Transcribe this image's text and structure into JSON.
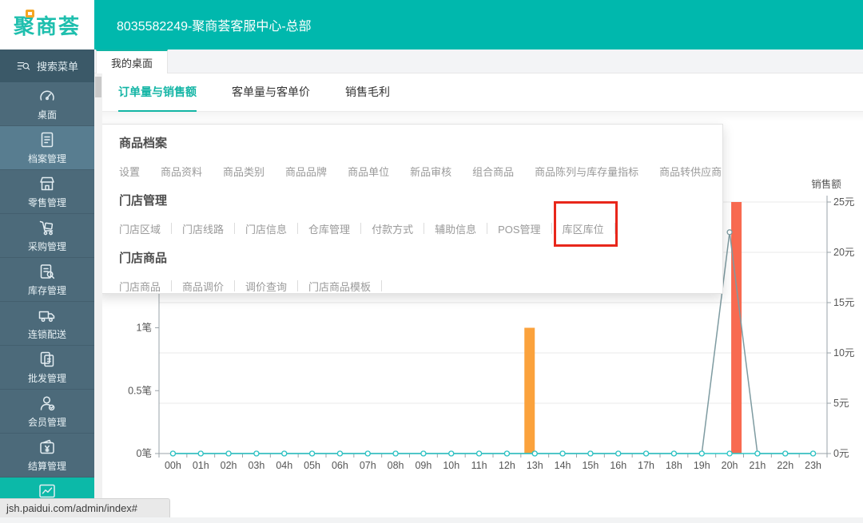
{
  "header": {
    "logo_text": "聚商荟",
    "window_title": "8035582249-聚商荟客服中心-总部"
  },
  "browser_tab": {
    "label": "我的桌面"
  },
  "search_menu": {
    "label": "搜索菜单",
    "icon": "search-menu-icon"
  },
  "sidebar": {
    "items": [
      {
        "label": "桌面",
        "icon": "dashboard-icon",
        "active": false
      },
      {
        "label": "档案管理",
        "icon": "archive-icon",
        "active": true
      },
      {
        "label": "零售管理",
        "icon": "store-icon",
        "active": false
      },
      {
        "label": "采购管理",
        "icon": "trolley-icon",
        "active": false
      },
      {
        "label": "库存管理",
        "icon": "inventory-search-icon",
        "active": false
      },
      {
        "label": "连锁配送",
        "icon": "truck-icon",
        "active": false
      },
      {
        "label": "批发管理",
        "icon": "documents-icon",
        "active": false
      },
      {
        "label": "会员管理",
        "icon": "member-icon",
        "active": false
      },
      {
        "label": "结算管理",
        "icon": "wallet-icon",
        "active": false
      },
      {
        "label": "",
        "icon": "line-chart-icon",
        "active": true,
        "partial": true
      }
    ]
  },
  "subtabs": [
    {
      "label": "订单量与销售额",
      "active": true
    },
    {
      "label": "客单量与客单价",
      "active": false
    },
    {
      "label": "销售毛利",
      "active": false
    }
  ],
  "menu": {
    "sections": [
      {
        "title": "商品档案",
        "items": [
          "设置",
          "商品资料",
          "商品类别",
          "商品品牌",
          "商品单位",
          "新品审核",
          "组合商品",
          "商品陈列与库存量指标",
          "商品转供应商"
        ]
      },
      {
        "title": "门店管理",
        "items": [
          "门店区域",
          "门店线路",
          "门店信息",
          "仓库管理",
          "付款方式",
          "辅助信息",
          "POS管理",
          "库区库位"
        ]
      },
      {
        "title": "门店商品",
        "items": [
          "门店商品",
          "商品调价",
          "调价查询",
          "门店商品模板"
        ]
      }
    ],
    "highlighted_item": "库区库位",
    "highlight_color": "#e8271b"
  },
  "chart_data": {
    "type": "bar+line combo",
    "categories": [
      "00h",
      "01h",
      "02h",
      "03h",
      "04h",
      "05h",
      "06h",
      "07h",
      "08h",
      "09h",
      "10h",
      "11h",
      "12h",
      "13h",
      "14h",
      "15h",
      "16h",
      "17h",
      "18h",
      "19h",
      "20h",
      "21h",
      "22h",
      "23h"
    ],
    "left_axis": {
      "unit": "笔",
      "max": 2,
      "visible_ticks": [
        {
          "label": "0笔",
          "value": 0
        },
        {
          "label": "0.5笔",
          "value": 0.5
        },
        {
          "label": "1笔",
          "value": 1
        }
      ]
    },
    "right_axis": {
      "title": "销售额",
      "unit": "元",
      "max": 25,
      "ticks": [
        {
          "label": "0元",
          "value": 0
        },
        {
          "label": "5元",
          "value": 5
        },
        {
          "label": "10元",
          "value": 10
        },
        {
          "label": "15元",
          "value": 15
        },
        {
          "label": "20元",
          "value": 20
        },
        {
          "label": "25元",
          "value": 25
        }
      ]
    },
    "grid": "horizontal lines at every 5元 step",
    "legend_visible": false,
    "series": [
      {
        "id": "bar-orange",
        "type": "bar",
        "axis": "left",
        "slot": 0,
        "color": "#fba23c",
        "values": [
          0,
          0,
          0,
          0,
          0,
          0,
          0,
          0,
          0,
          0,
          0,
          0,
          0,
          1,
          0,
          0,
          0,
          0,
          0,
          0,
          0,
          0,
          0,
          0
        ]
      },
      {
        "id": "bar-red",
        "type": "bar",
        "axis": "left",
        "slot": 1,
        "color": "#f86a50",
        "values": [
          0,
          0,
          0,
          0,
          0,
          0,
          0,
          0,
          0,
          0,
          0,
          0,
          0,
          0,
          0,
          0,
          0,
          0,
          0,
          0,
          2,
          0,
          0,
          0
        ]
      },
      {
        "id": "line-gray",
        "type": "line",
        "axis": "right",
        "color": "#7e9ba1",
        "values": [
          0,
          0,
          0,
          0,
          0,
          0,
          0,
          0,
          0,
          0,
          0,
          0,
          0,
          0,
          0,
          0,
          0,
          0,
          0,
          0,
          22,
          0,
          0,
          0
        ]
      },
      {
        "id": "line-teal",
        "type": "line",
        "axis": "right",
        "color": "#2cc5c6",
        "values": [
          0,
          0,
          0,
          0,
          0,
          0,
          0,
          0,
          0,
          0,
          0,
          0,
          0,
          0,
          0,
          0,
          0,
          0,
          0,
          0,
          0,
          0,
          0,
          0
        ]
      }
    ]
  },
  "browser_status": "jsh.paidui.com/admin/index#",
  "colors": {
    "header_teal": "#00b8ad",
    "accent_teal": "#13b5a5",
    "sidebar_bg": "#4c6a7a",
    "sidebar_active_bg": "#587d90",
    "bar_orange": "#fba23c",
    "bar_red": "#f86a50",
    "line_teal": "#2cc5c6",
    "line_gray": "#7e9ba1",
    "highlight_red": "#e8271b",
    "logo_orange": "#f5a623"
  }
}
